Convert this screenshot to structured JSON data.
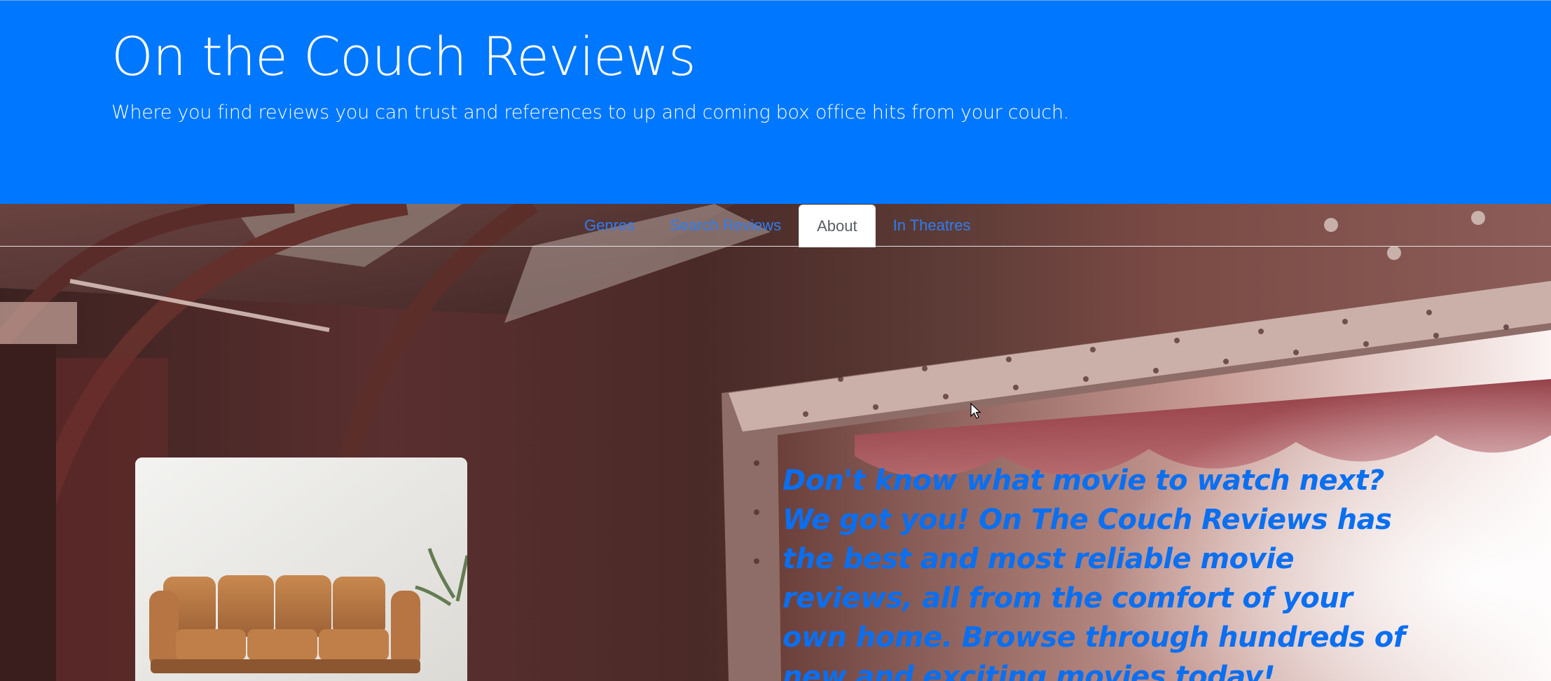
{
  "header": {
    "title": "On the Couch Reviews",
    "subtitle": "Where you find reviews you can trust and references to up and coming box office hits from your couch."
  },
  "nav": {
    "tabs": [
      {
        "label": "Genres",
        "active": false
      },
      {
        "label": "Search Reviews",
        "active": false
      },
      {
        "label": "About",
        "active": true
      },
      {
        "label": "In Theatres",
        "active": false
      }
    ]
  },
  "main": {
    "tagline": "Don't know what movie to watch next? We got you! On The Couch Reviews has the best and most reliable movie reviews, all from the comfort of your own home. Browse through hundreds of new and exciting movies today!",
    "couch_image": "couch-photo"
  },
  "colors": {
    "header_bg": "#0077ff",
    "link": "#2f7df2",
    "tagline": "#0a6ff0"
  }
}
